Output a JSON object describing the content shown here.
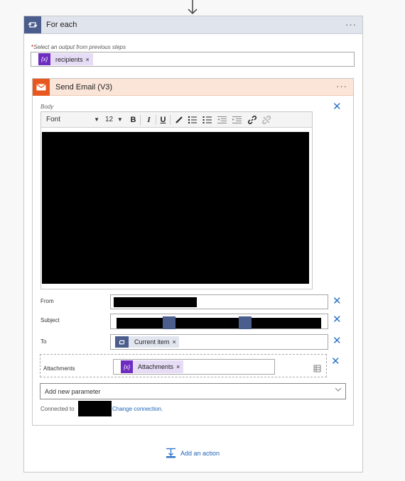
{
  "foreach": {
    "title": "For each",
    "more": "···",
    "select_label": "Select an output from previous steps",
    "required_star": "*",
    "token": {
      "icon": "{x}",
      "label": "recipients",
      "remove": "×"
    }
  },
  "send_email": {
    "title": "Send Email (V3)",
    "more": "···",
    "body_label": "Body",
    "toolbar": {
      "font": "Font",
      "size": "12",
      "bold": "B",
      "italic": "I",
      "underline": "U"
    },
    "from_label": "From",
    "subject_label": "Subject",
    "to_label": "To",
    "to_token": {
      "label": "Current item",
      "remove": "×"
    },
    "attachments_label": "Attachments",
    "attachments_token": {
      "icon": "{x}",
      "label": "Attachments",
      "remove": "×"
    },
    "add_param": "Add new parameter",
    "connected_to": "Connected to",
    "change_connection": "Change connection."
  },
  "footer": {
    "add_action": "Add an action"
  },
  "colors": {
    "foreach_header": "#e0e4ec",
    "foreach_icon": "#4a5d8c",
    "email_header": "#fbe5d9",
    "email_icon": "#e8571e",
    "dynamic_token": "#6e2dbf",
    "link": "#1f64b8",
    "close_x": "#2b74c7"
  }
}
